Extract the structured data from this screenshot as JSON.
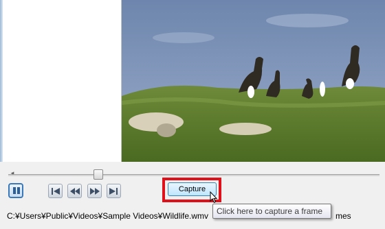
{
  "video": {
    "description_icon": "video-frame"
  },
  "controls": {
    "pause_icon": "pause-icon",
    "first_icon": "skip-to-start-icon",
    "prev_icon": "step-back-icon",
    "next_icon": "step-forward-icon",
    "last_icon": "skip-to-end-icon",
    "capture_label": "Capture",
    "highlight_color": "#e0101a"
  },
  "seekbar": {
    "position": 0.23
  },
  "tooltip": {
    "text": "Click here to capture a frame"
  },
  "status": {
    "path": "C:¥Users¥Public¥Videos¥Sample Videos¥Wildlife.wmv",
    "suffix": "mes"
  }
}
